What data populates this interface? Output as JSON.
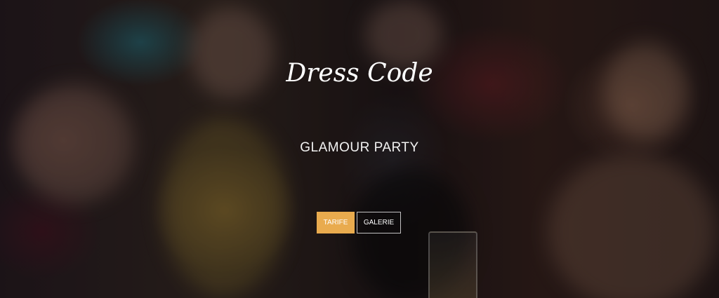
{
  "hero": {
    "title": "Dress Code",
    "subtitle": "GLAMOUR PARTY",
    "buttons": {
      "primary_label": "TARIFE",
      "secondary_label": "GALERIE"
    },
    "colors": {
      "accent": "#e9ab4e",
      "text": "#ffffff"
    }
  }
}
